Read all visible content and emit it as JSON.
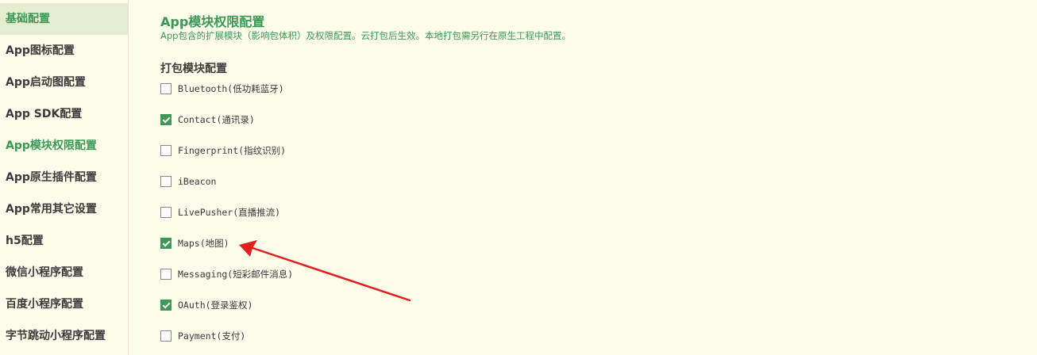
{
  "sidebar": {
    "items": [
      {
        "label": "基础配置"
      },
      {
        "label": "App图标配置"
      },
      {
        "label": "App启动图配置"
      },
      {
        "label": "App SDK配置"
      },
      {
        "label": "App模块权限配置"
      },
      {
        "label": "App原生插件配置"
      },
      {
        "label": "App常用其它设置"
      },
      {
        "label": "h5配置"
      },
      {
        "label": "微信小程序配置"
      },
      {
        "label": "百度小程序配置"
      },
      {
        "label": "字节跳动小程序配置"
      }
    ],
    "selected_index": 0,
    "active_index": 4
  },
  "main": {
    "title": "App模块权限配置",
    "description": "App包含的扩展模块（影响包体积）及权限配置。云打包后生效。本地打包需另行在原生工程中配置。",
    "section_title": "打包模块配置",
    "options": [
      {
        "label": "Bluetooth(低功耗蓝牙)",
        "checked": false
      },
      {
        "label": "Contact(通讯录)",
        "checked": true
      },
      {
        "label": "Fingerprint(指纹识别)",
        "checked": false
      },
      {
        "label": "iBeacon",
        "checked": false
      },
      {
        "label": "LivePusher(直播推流)",
        "checked": false
      },
      {
        "label": "Maps(地图)",
        "checked": true
      },
      {
        "label": "Messaging(短彩邮件消息)",
        "checked": false
      },
      {
        "label": "OAuth(登录鉴权)",
        "checked": true
      },
      {
        "label": "Payment(支付)",
        "checked": false
      }
    ]
  },
  "colors": {
    "background": "#fdfbea",
    "accent": "#3a9a55",
    "selected_bg": "#e5eccf",
    "text": "#3b3b3b",
    "annotation_arrow": "#e02020"
  }
}
